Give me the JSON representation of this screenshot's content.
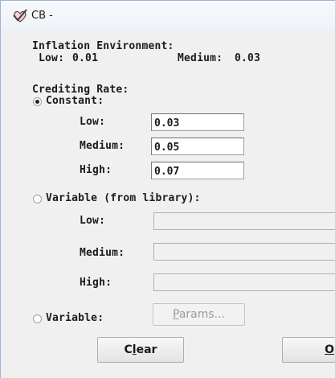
{
  "window": {
    "title": "CB -"
  },
  "inflation": {
    "heading": "Inflation Environment:",
    "low_label": "Low:",
    "low_value": "0.01",
    "medium_label": "Medium:",
    "medium_value": "0.03"
  },
  "crediting": {
    "heading": "Crediting Rate:",
    "selected": "constant",
    "constant": {
      "label": "Constant:",
      "low_label": "Low:",
      "low_value": "0.03",
      "medium_label": "Medium:",
      "medium_value": "0.05",
      "high_label": "High:",
      "high_value": "0.07"
    },
    "variable_library": {
      "label": "Variable (from library):",
      "low_label": "Low:",
      "low_value": "",
      "medium_label": "Medium:",
      "medium_value": "",
      "high_label": "High:",
      "high_value": ""
    },
    "variable": {
      "label": "Variable:",
      "params_button": {
        "mnemonic": "P",
        "rest": "arams..."
      }
    }
  },
  "buttons": {
    "clear": {
      "pre": "C",
      "mnemonic": "l",
      "post": "ear"
    },
    "ok": {
      "pre": "",
      "mnemonic": "O",
      "post": ""
    }
  },
  "icons": {
    "app": "checkmark-heart-icon",
    "radio": "radio-icon"
  }
}
